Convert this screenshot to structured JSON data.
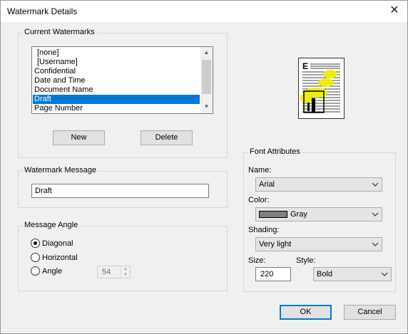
{
  "window": {
    "title": "Watermark Details",
    "close_glyph": "✕"
  },
  "current_watermarks": {
    "label": "Current Watermarks",
    "items": [
      "[none]",
      "[Username]",
      "Confidential",
      "Date and Time",
      "Document Name",
      "Draft",
      "Page Number"
    ],
    "selected": "Draft",
    "new_label": "New",
    "delete_label": "Delete"
  },
  "watermark_message": {
    "label": "Watermark Message",
    "value": "Draft"
  },
  "message_angle": {
    "label": "Message Angle",
    "options": [
      "Diagonal",
      "Horizontal",
      "Angle"
    ],
    "selected": "Diagonal",
    "angle_value": "54"
  },
  "font_attributes": {
    "label": "Font Attributes",
    "name_label": "Name:",
    "name_value": "Arial",
    "color_label": "Color:",
    "color_value": "Gray",
    "color_swatch": "#808080",
    "shading_label": "Shading:",
    "shading_value": "Very light",
    "size_label": "Size:",
    "size_value": "220",
    "style_label": "Style:",
    "style_value": "Bold"
  },
  "preview": {
    "letter": "E",
    "watermark_color": "#f0f000"
  },
  "footer": {
    "ok_label": "OK",
    "cancel_label": "Cancel"
  },
  "colors": {
    "selection": "#0078d7",
    "face": "#f0f0f0"
  }
}
